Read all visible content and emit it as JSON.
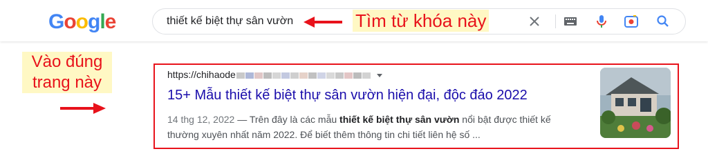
{
  "logo": {
    "letters": [
      "G",
      "o",
      "o",
      "g",
      "l",
      "e"
    ],
    "colors": [
      "#4285F4",
      "#EA4335",
      "#FBBC05",
      "#4285F4",
      "#34A853",
      "#EA4335"
    ]
  },
  "search": {
    "query": "thiết kế biệt thự sân vườn",
    "icons": [
      "close-icon",
      "keyboard-icon",
      "microphone-icon",
      "camera-icon",
      "search-icon"
    ]
  },
  "annotations": {
    "top_callout": "Tìm từ khóa này",
    "left_callout": "Vào đúng trang này",
    "accent_color": "#e8121b",
    "highlight_bg": "#fff8c4"
  },
  "result": {
    "url": "https://chihaode",
    "title": "15+ Mẫu thiết kế biệt thự sân vườn hiện đại, độc đáo 2022",
    "date": "14 thg 12, 2022",
    "snippet_before": " — Trên đây là các mẫu ",
    "snippet_bold": "thiết kế biệt thự sân vườn",
    "snippet_after": " nổi bật được thiết kế thường xuyên nhất năm 2022. Để biết thêm thông tin chi tiết liên hệ số ...",
    "link_color": "#1a0dab"
  }
}
